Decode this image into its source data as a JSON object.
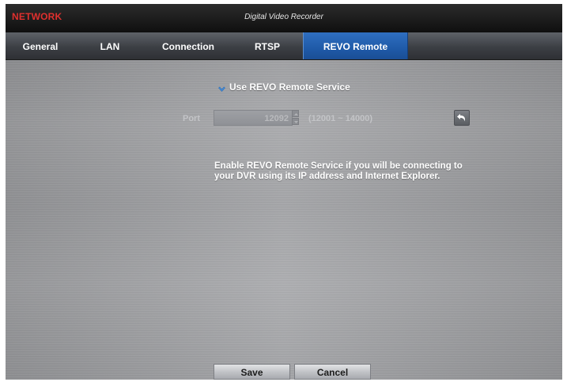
{
  "titlebar": {
    "section": "NETWORK",
    "app_title": "Digital Video Recorder"
  },
  "tabs": [
    {
      "label": "General",
      "active": false
    },
    {
      "label": "LAN",
      "active": false
    },
    {
      "label": "Connection",
      "active": false
    },
    {
      "label": "RTSP",
      "active": false
    },
    {
      "label": "REVO Remote",
      "active": true
    }
  ],
  "revo_remote": {
    "use_service": {
      "label": "Use REVO Remote Service",
      "checked": true
    },
    "port": {
      "label": "Port",
      "value": "12092",
      "range": "(12001 ~ 14000)",
      "enabled": false
    },
    "info": "Enable REVO Remote Service if you will be connecting to your DVR using its IP address and Internet Explorer."
  },
  "footer": {
    "save_label": "Save",
    "cancel_label": "Cancel"
  },
  "icons": {
    "check": "check-icon",
    "undo": "undo-icon",
    "spin_up": "chevron-up-icon",
    "spin_down": "chevron-down-icon"
  },
  "colors": {
    "title_accent": "#e0302e",
    "active_tab": "#1f5aa8",
    "panel_bg": "#a2a3a6"
  }
}
